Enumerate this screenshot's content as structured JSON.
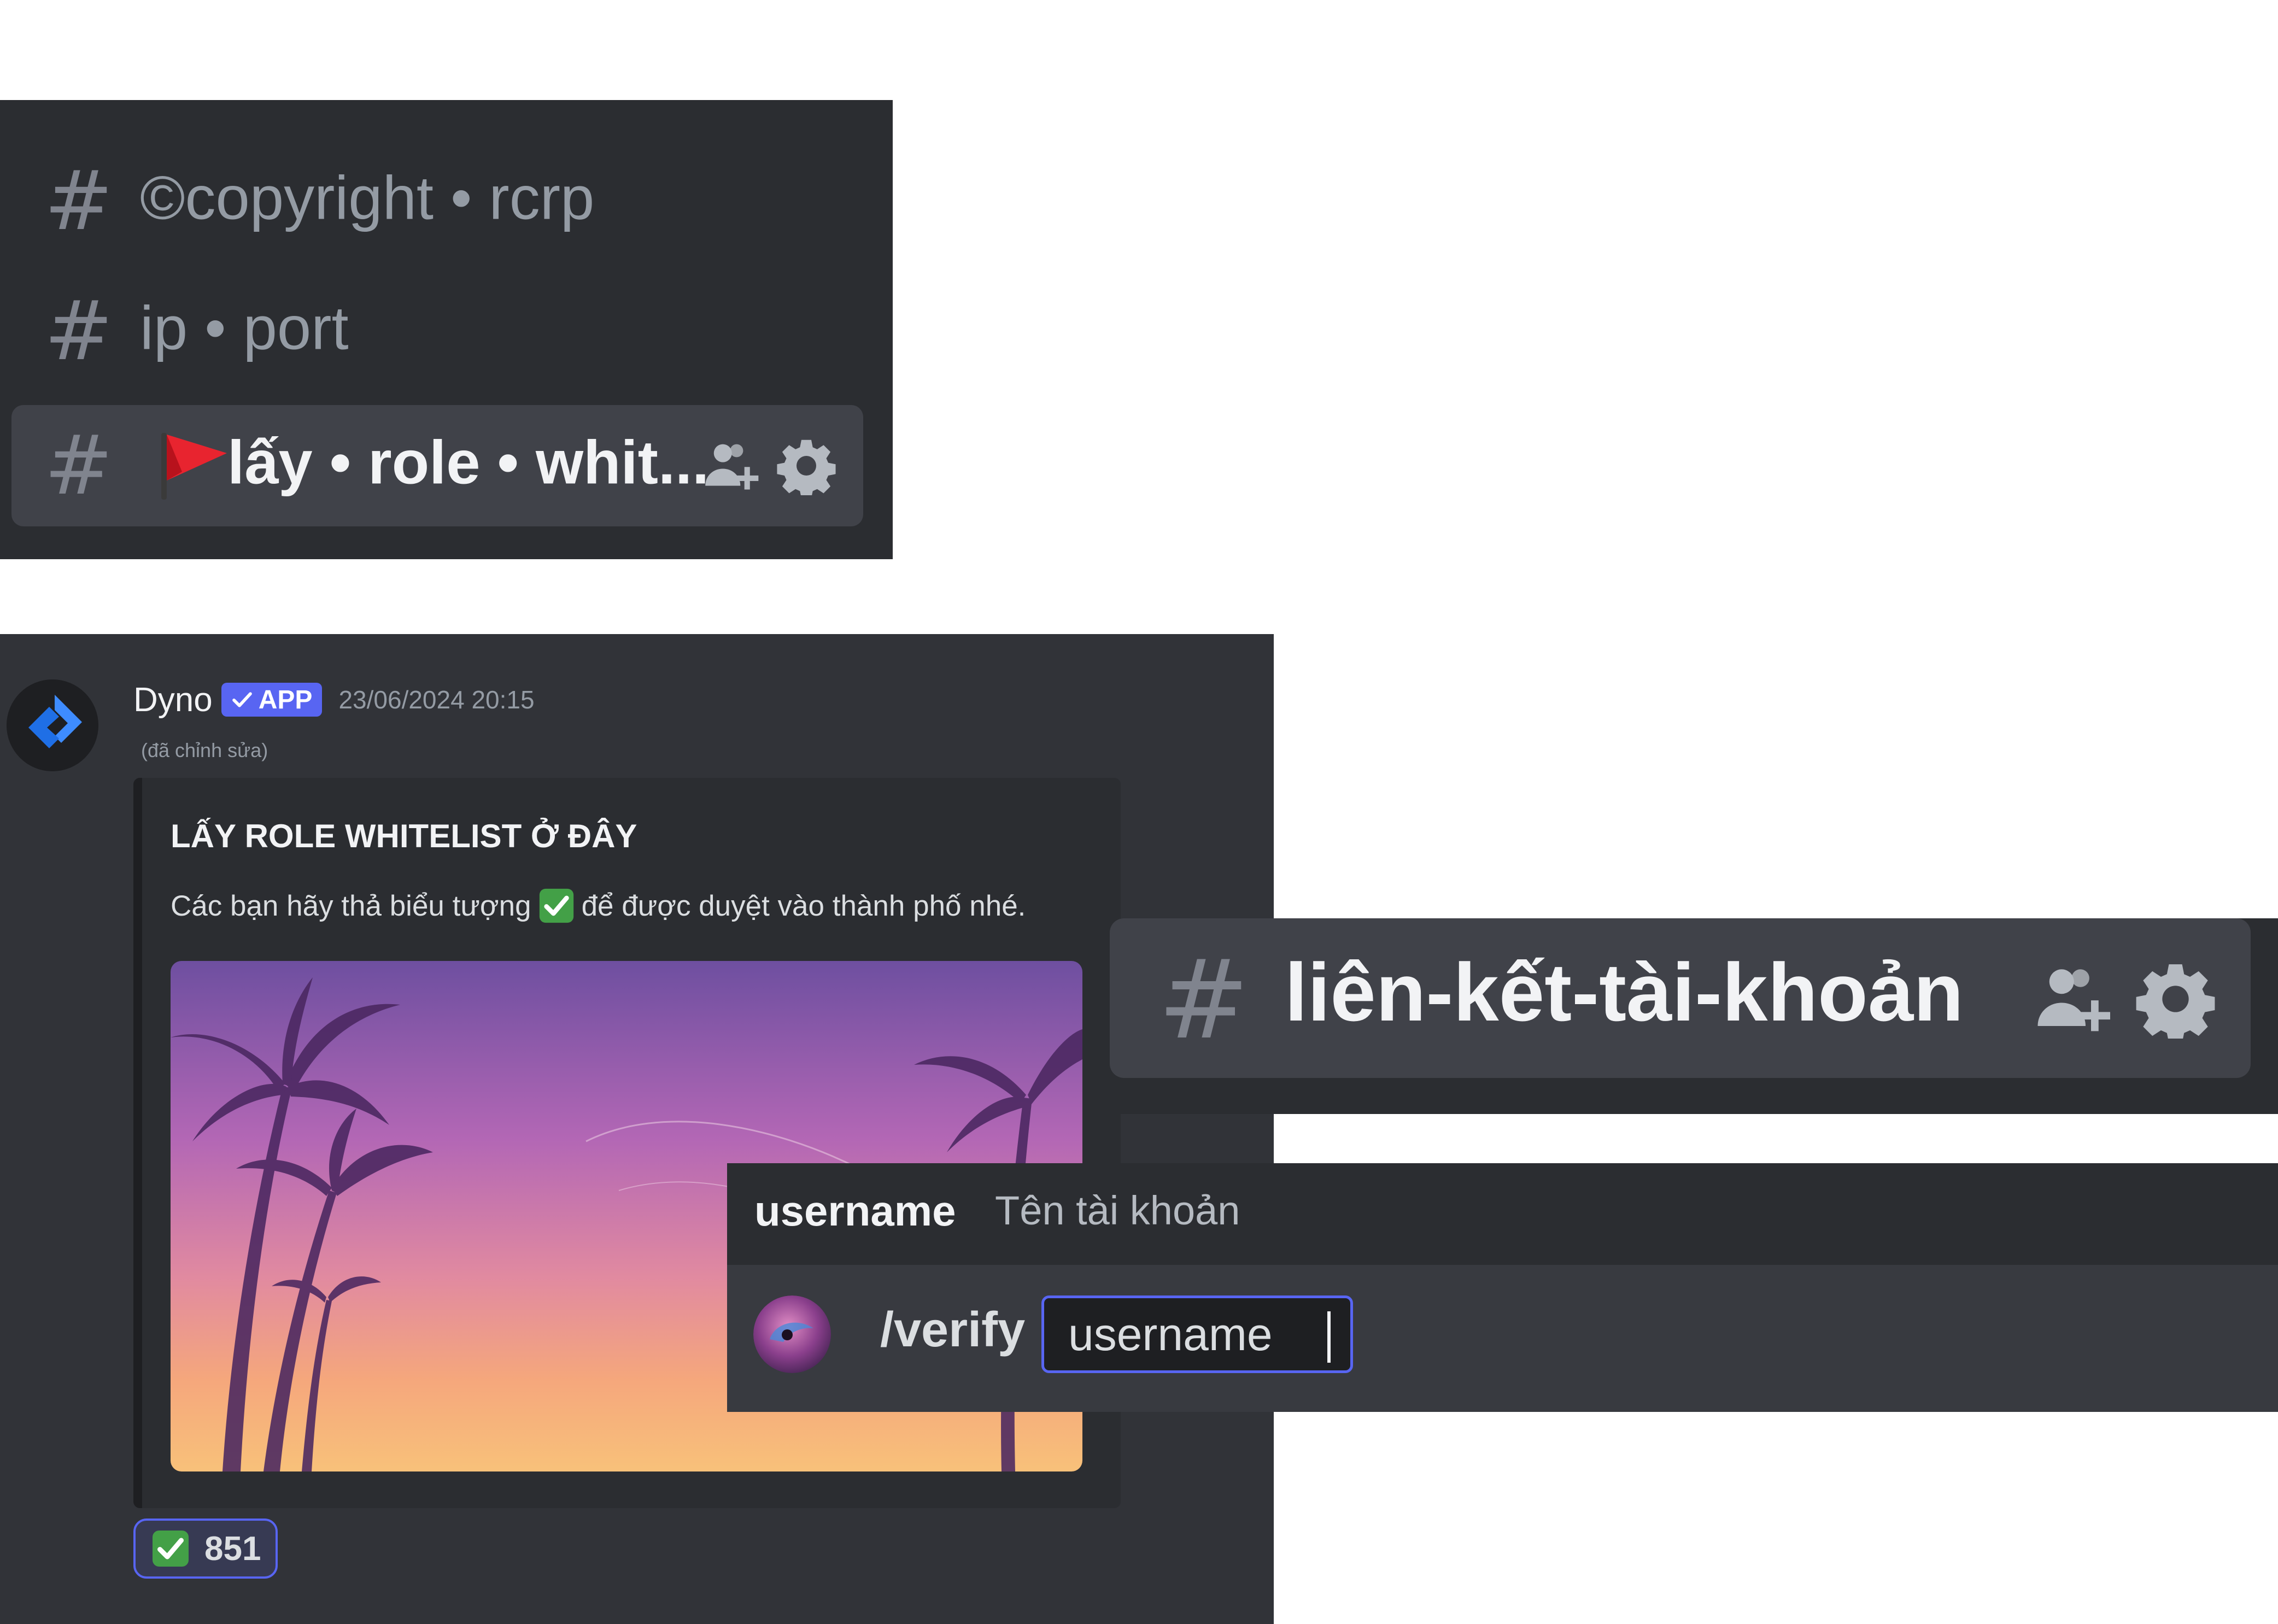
{
  "channels": {
    "items": [
      {
        "name": "©copyright • rcrp",
        "active": false
      },
      {
        "name": "ip • port",
        "active": false
      },
      {
        "name": "lấy • role • whit...",
        "active": true,
        "emoji": "red-flag-icon"
      }
    ]
  },
  "message": {
    "author": "Dyno",
    "badge": "APP",
    "timestamp": "23/06/2024 20:15",
    "edited": "(đã chỉnh sửa)",
    "embed": {
      "title": "LẤY ROLE WHITELIST Ở ĐÂY",
      "description_before": "Các bạn hãy thả biểu tượng",
      "description_after": "để được duyệt vào thành phố nhé.",
      "image": "sunset-palm-trees"
    },
    "reaction": {
      "emoji": "check-mark-button",
      "count": "851"
    }
  },
  "channel_header": {
    "name": "liên-kết-tài-khoản"
  },
  "slash_command": {
    "option_name": "username",
    "option_description": "Tên tài khoản",
    "command": "/verify",
    "input_value": "username"
  },
  "colors": {
    "background": "#313338",
    "sidebar": "#2b2d31",
    "selected": "#404249",
    "blurple": "#5865f2",
    "check_green": "#43a047"
  }
}
